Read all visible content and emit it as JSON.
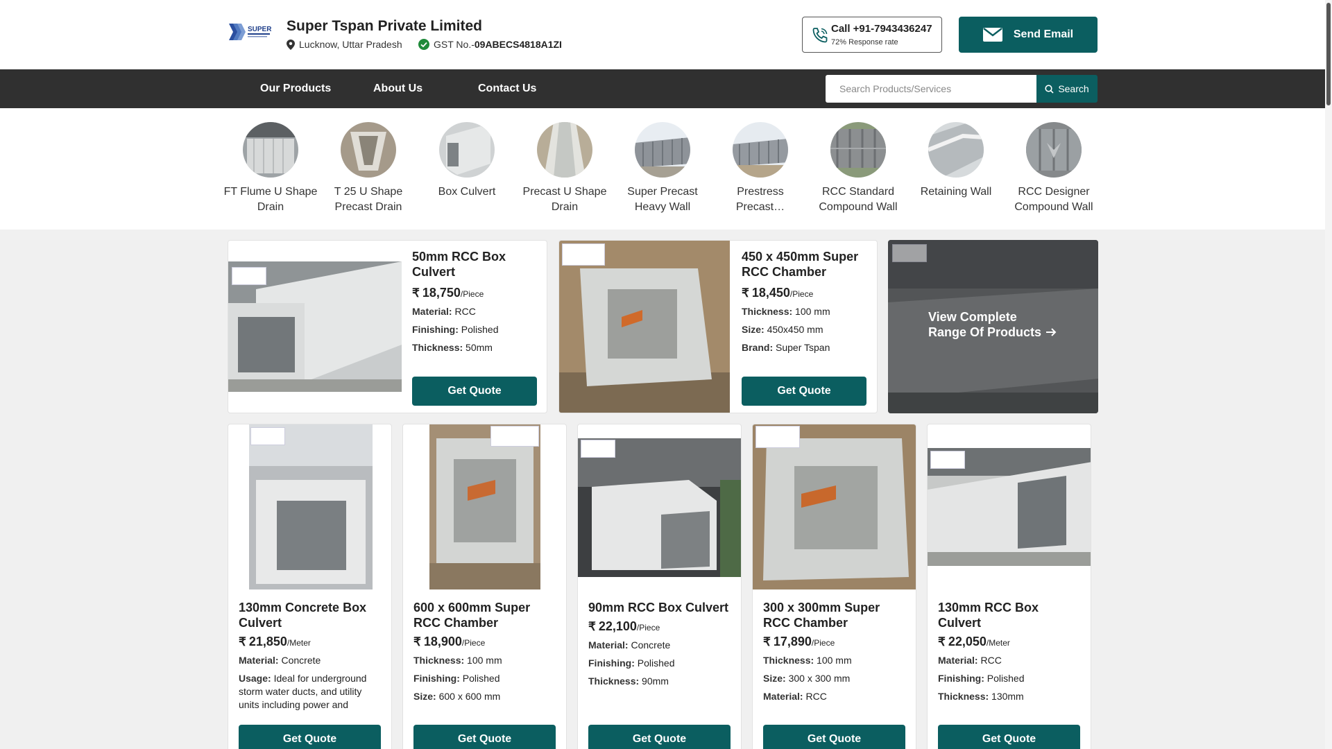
{
  "header": {
    "company_name": "Super Tspan Private Limited",
    "location": "Lucknow, Uttar Pradesh",
    "gst_label": "GST No.-",
    "gst_number": "09ABECS4818A1ZI",
    "call_label": "Call +91-7943436247",
    "response_rate": "72% Response rate",
    "email_label": "Send Email",
    "logo_text": "SUPER"
  },
  "nav": {
    "items": [
      "Our Products",
      "About Us",
      "Contact Us"
    ],
    "search_placeholder": "Search Products/Services",
    "search_label": "Search"
  },
  "categories": [
    {
      "label": "FT Flume U Shape Drain"
    },
    {
      "label": "T 25 U Shape Precast Drain"
    },
    {
      "label": "Box Culvert"
    },
    {
      "label": "Precast U Shape Drain"
    },
    {
      "label": "Super Precast Heavy Wall"
    },
    {
      "label": "Prestress Precast…"
    },
    {
      "label": "RCC Standard Compound Wall"
    },
    {
      "label": "Retaining Wall"
    },
    {
      "label": "RCC Designer Compound Wall"
    }
  ],
  "featured": [
    {
      "title": "50mm RCC Box Culvert",
      "price": "18,750",
      "unit": "/Piece",
      "specs": [
        {
          "k": "Material:",
          "v": "RCC"
        },
        {
          "k": "Finishing:",
          "v": "Polished"
        },
        {
          "k": "Thickness:",
          "v": "50mm"
        }
      ],
      "cta": "Get Quote"
    },
    {
      "title": "450 x 450mm Super RCC Chamber",
      "price": "18,450",
      "unit": "/Piece",
      "specs": [
        {
          "k": "Thickness:",
          "v": "100 mm"
        },
        {
          "k": "Size:",
          "v": "450x450 mm"
        },
        {
          "k": "Brand:",
          "v": "Super Tspan"
        }
      ],
      "cta": "Get Quote"
    }
  ],
  "view_all": {
    "line1": "View Complete",
    "line2": "Range Of Products"
  },
  "products": [
    {
      "title": "130mm Concrete Box Culvert",
      "price": "21,850",
      "unit": "/Meter",
      "specs": [
        {
          "k": "Material:",
          "v": "Concrete"
        },
        {
          "k": "Usage:",
          "v": "Ideal for underground storm water ducts, and utility units including power and telecom lines"
        }
      ],
      "cta": "Get Quote"
    },
    {
      "title": "600 x 600mm Super RCC Chamber",
      "price": "18,900",
      "unit": "/Piece",
      "specs": [
        {
          "k": "Thickness:",
          "v": "100 mm"
        },
        {
          "k": "Finishing:",
          "v": "Polished"
        },
        {
          "k": "Size:",
          "v": "600 x 600 mm"
        }
      ],
      "cta": "Get Quote"
    },
    {
      "title": "90mm RCC Box Culvert",
      "price": "22,100",
      "unit": "/Piece",
      "specs": [
        {
          "k": "Material:",
          "v": "Concrete"
        },
        {
          "k": "Finishing:",
          "v": "Polished"
        },
        {
          "k": "Thickness:",
          "v": "90mm"
        }
      ],
      "cta": "Get Quote"
    },
    {
      "title": "300 x 300mm Super RCC Chamber",
      "price": "17,890",
      "unit": "/Piece",
      "specs": [
        {
          "k": "Thickness:",
          "v": "100 mm"
        },
        {
          "k": "Size:",
          "v": "300 x 300 mm"
        },
        {
          "k": "Material:",
          "v": "RCC"
        }
      ],
      "cta": "Get Quote"
    },
    {
      "title": "130mm RCC Box Culvert",
      "price": "22,050",
      "unit": "/Meter",
      "specs": [
        {
          "k": "Material:",
          "v": "RCC"
        },
        {
          "k": "Finishing:",
          "v": "Polished"
        },
        {
          "k": "Thickness:",
          "v": "130mm"
        }
      ],
      "cta": "Get Quote"
    }
  ],
  "currency_symbol": "₹",
  "colors": {
    "brand": "#0b5e60",
    "nav": "#303030",
    "page_bg": "#f0f0f0"
  },
  "icons": [
    "location-pin-icon",
    "verified-check-icon",
    "phone-icon",
    "mail-icon",
    "search-icon",
    "arrow-right-icon"
  ]
}
